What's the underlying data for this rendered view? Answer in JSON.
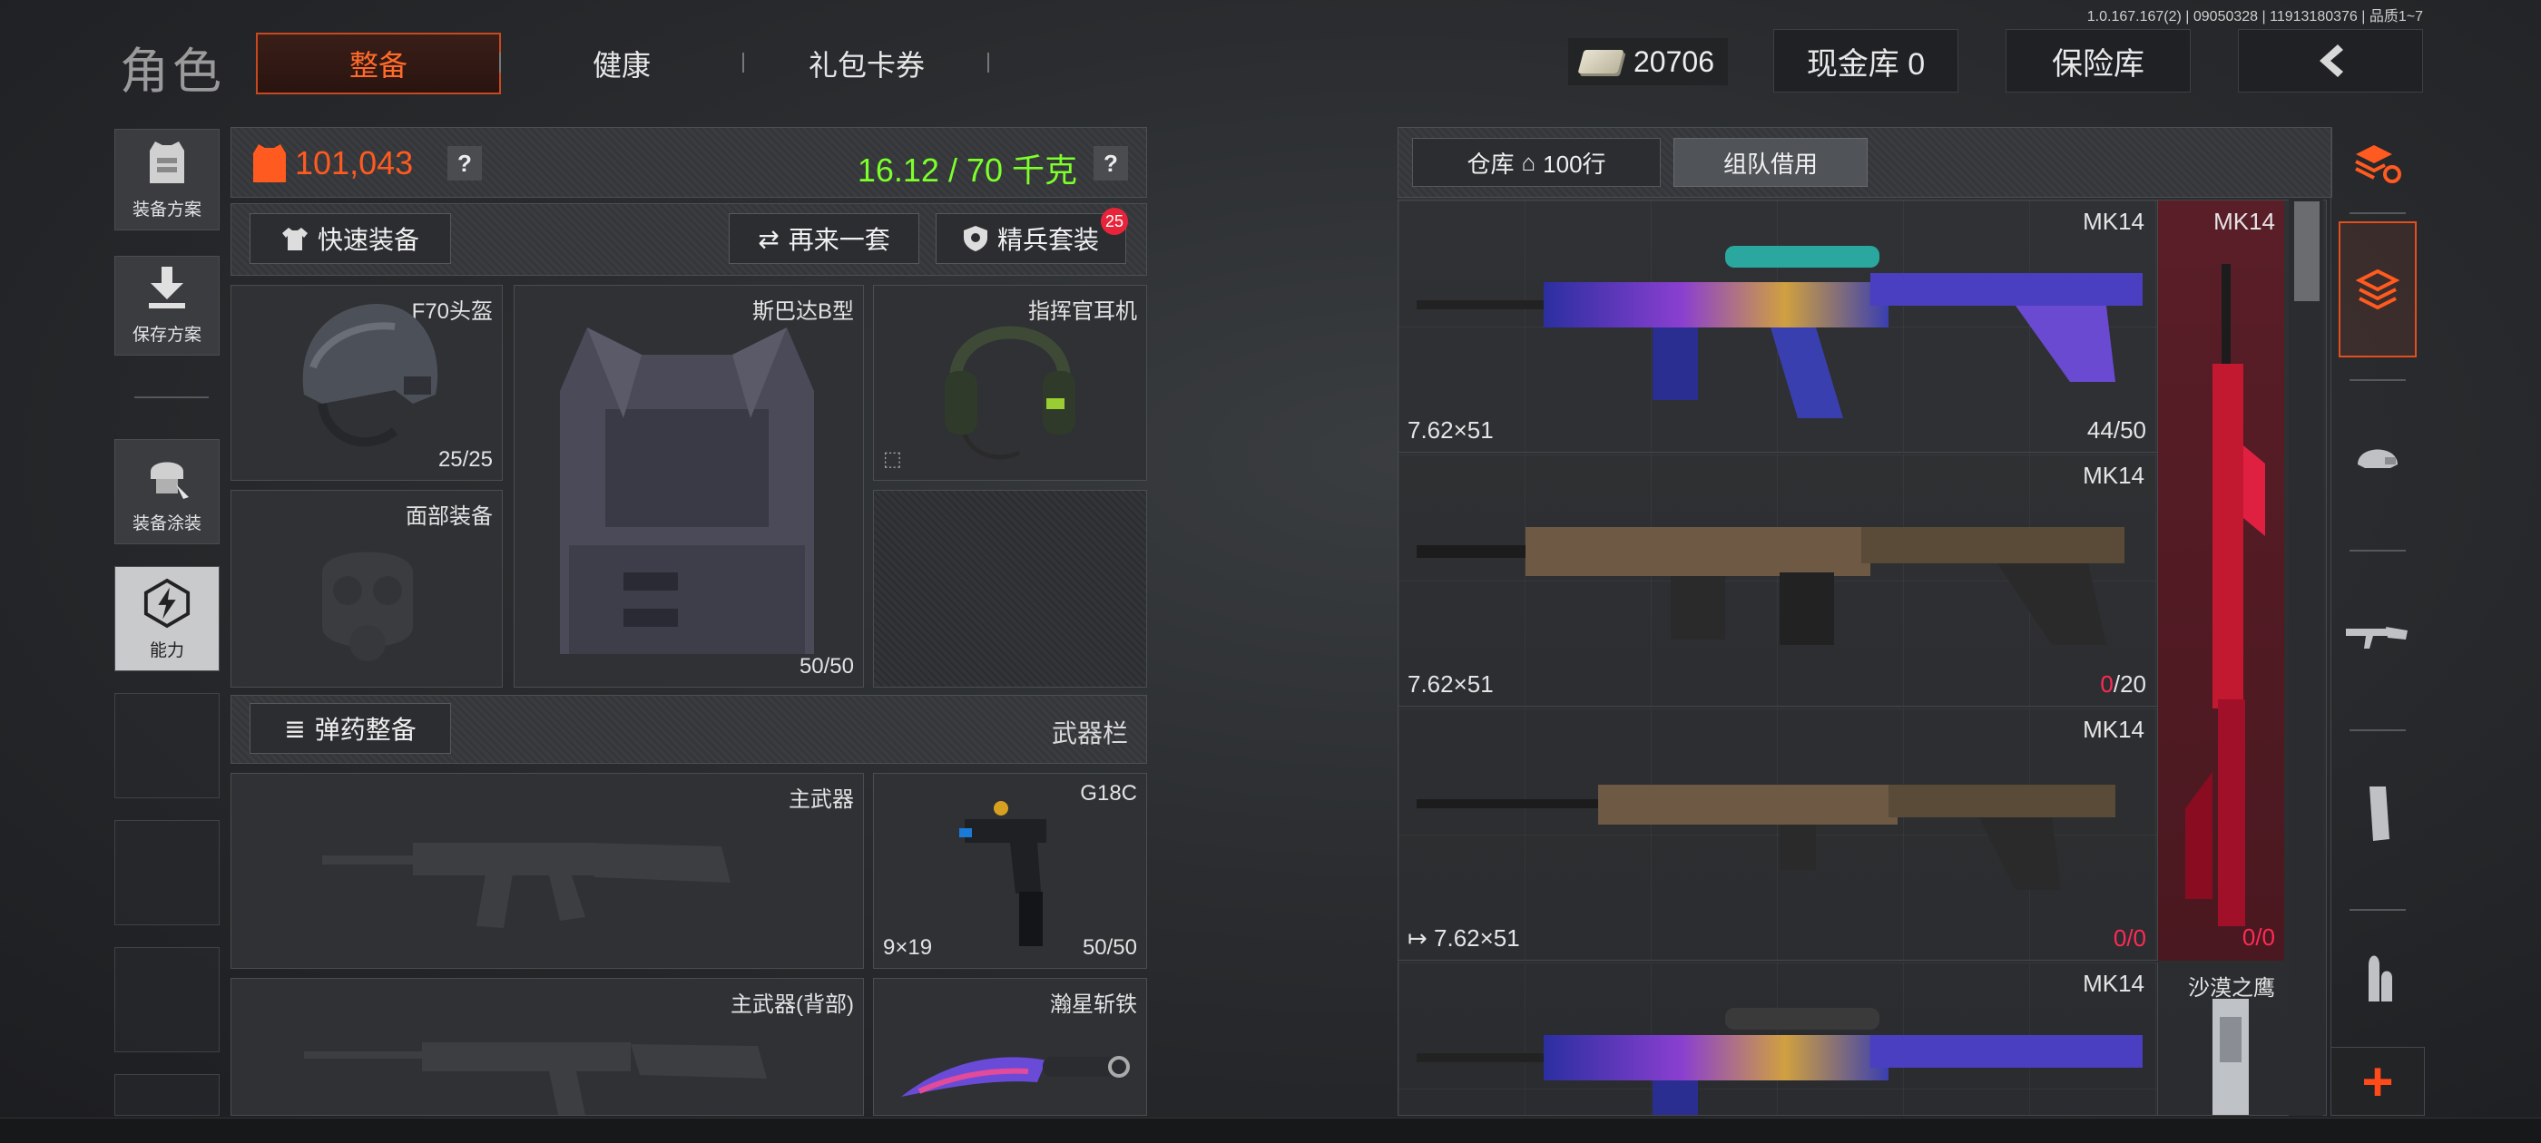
{
  "version": "1.0.167.167(2) | 09050328 | 11913180376 | 品质1~7",
  "header": {
    "title": "角色",
    "tabs": [
      {
        "label": "整备",
        "active": true
      },
      {
        "label": "健康",
        "active": false
      },
      {
        "label": "礼包卡券",
        "active": false
      }
    ],
    "money": "20706",
    "cash_vault": "现金库 0",
    "safe_box": "保险库",
    "back_icon": "chevron-left-icon"
  },
  "sidebar": {
    "items": [
      {
        "label": "装备方案",
        "icon": "armor-icon"
      },
      {
        "label": "保存方案",
        "icon": "download-icon"
      },
      {
        "label": "装备涂装",
        "icon": "paint-icon"
      },
      {
        "label": "能力",
        "icon": "lightning-icon"
      }
    ]
  },
  "loadout": {
    "value": "101,043",
    "weight": "16.12 / 70 千克",
    "help": "?",
    "quick_equip": "快速装备",
    "again": "再来一套",
    "elite": "精兵套装",
    "elite_badge": "25",
    "slots": {
      "helmet": {
        "label": "F70头盔",
        "durability": "25/25"
      },
      "armor": {
        "label": "斯巴达B型",
        "durability": "50/50"
      },
      "headset": {
        "label": "指挥官耳机"
      },
      "face": {
        "label": "面部装备"
      }
    },
    "ammo_equip": "弹药整备",
    "weapon_bar": "武器栏",
    "weapons": {
      "primary": {
        "label": "主武器"
      },
      "secondary_pistol": {
        "label": "G18C",
        "caliber": "9×19",
        "ammo": "50/50"
      },
      "primary_back": {
        "label": "主武器(背部)"
      },
      "melee": {
        "label": "瀚星斩铁"
      }
    }
  },
  "warehouse": {
    "tab_warehouse": "仓库",
    "tab_rows": "100行",
    "tab_team": "组队借用",
    "items": [
      {
        "name": "MK14",
        "caliber": "7.62×51",
        "ammo_cur": "44",
        "ammo_max": "/50",
        "empty": false
      },
      {
        "name": "MK14",
        "caliber": "7.62×51",
        "ammo_cur": "0",
        "ammo_max": "/20",
        "empty": true
      },
      {
        "name": "MK14",
        "caliber": "7.62×51",
        "ammo_cur": "0",
        "ammo_max": "/0",
        "empty": true
      },
      {
        "name": "MK14",
        "caliber": "",
        "ammo_cur": "",
        "ammo_max": "",
        "empty": false
      }
    ],
    "side_item": {
      "name": "MK14",
      "ammo_cur": "0",
      "ammo_max": "/0"
    },
    "side_item2": {
      "name": "沙漠之鹰"
    }
  },
  "categories": [
    "stack-refresh-icon",
    "stack-icon",
    "helmet-icon",
    "rifle-icon",
    "magazine-icon",
    "ammo-icon"
  ],
  "colors": {
    "accent": "#ff5a1f",
    "weight": "#7cff2a",
    "ammo_empty": "#ff2a55"
  }
}
